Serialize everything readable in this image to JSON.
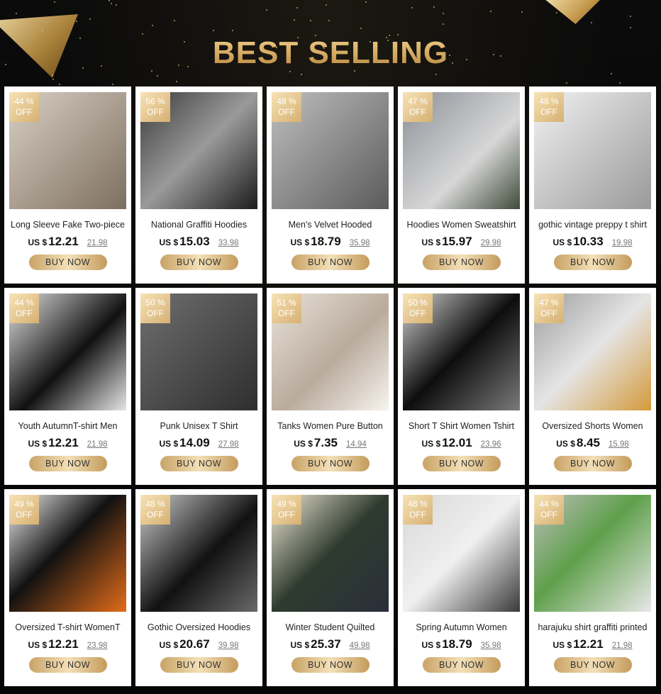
{
  "header": {
    "title": "BEST SELLING"
  },
  "currency_label": "US $",
  "buy_label": "BUY NOW",
  "colors": {
    "accent_gold": "#d2a763",
    "background": "#070707"
  },
  "products": [
    {
      "discount_pct": "44 %",
      "discount_off": "OFF",
      "name": "Long Sleeve Fake Two-piece",
      "price": "12.21",
      "old_price": "21.98"
    },
    {
      "discount_pct": "56 %",
      "discount_off": "OFF",
      "name": "National Graffiti Hoodies",
      "price": "15.03",
      "old_price": "33.98"
    },
    {
      "discount_pct": "48 %",
      "discount_off": "OFF",
      "name": "Men's Velvet Hooded",
      "price": "18.79",
      "old_price": "35.98"
    },
    {
      "discount_pct": "47 %",
      "discount_off": "OFF",
      "name": "Hoodies Women Sweatshirt",
      "price": "15.97",
      "old_price": "29.98"
    },
    {
      "discount_pct": "48 %",
      "discount_off": "OFF",
      "name": "gothic vintage preppy t shirt",
      "price": "10.33",
      "old_price": "19.98"
    },
    {
      "discount_pct": "44 %",
      "discount_off": "OFF",
      "name": "Youth AutumnT-shirt Men",
      "price": "12.21",
      "old_price": "21.98"
    },
    {
      "discount_pct": "50 %",
      "discount_off": "OFF",
      "name": "Punk Unisex T Shirt",
      "price": "14.09",
      "old_price": "27.98"
    },
    {
      "discount_pct": "51 %",
      "discount_off": "OFF",
      "name": "Tanks Women Pure Button",
      "price": "7.35",
      "old_price": "14.94"
    },
    {
      "discount_pct": "50 %",
      "discount_off": "OFF",
      "name": "Short T Shirt Women Tshirt",
      "price": "12.01",
      "old_price": "23.96"
    },
    {
      "discount_pct": "47 %",
      "discount_off": "OFF",
      "name": "Oversized Shorts Women",
      "price": "8.45",
      "old_price": "15.98"
    },
    {
      "discount_pct": "49 %",
      "discount_off": "OFF",
      "name": "Oversized T-shirt WomenT",
      "price": "12.21",
      "old_price": "23.98"
    },
    {
      "discount_pct": "48 %",
      "discount_off": "OFF",
      "name": "Gothic Oversized Hoodies",
      "price": "20.67",
      "old_price": "39.98"
    },
    {
      "discount_pct": "49 %",
      "discount_off": "OFF",
      "name": "Winter Student Quilted",
      "price": "25.37",
      "old_price": "49.98"
    },
    {
      "discount_pct": "48 %",
      "discount_off": "OFF",
      "name": "Spring Autumn Women",
      "price": "18.79",
      "old_price": "35.98"
    },
    {
      "discount_pct": "44 %",
      "discount_off": "OFF",
      "name": "harajuku shirt graffiti printed",
      "price": "12.21",
      "old_price": "21.98"
    }
  ]
}
